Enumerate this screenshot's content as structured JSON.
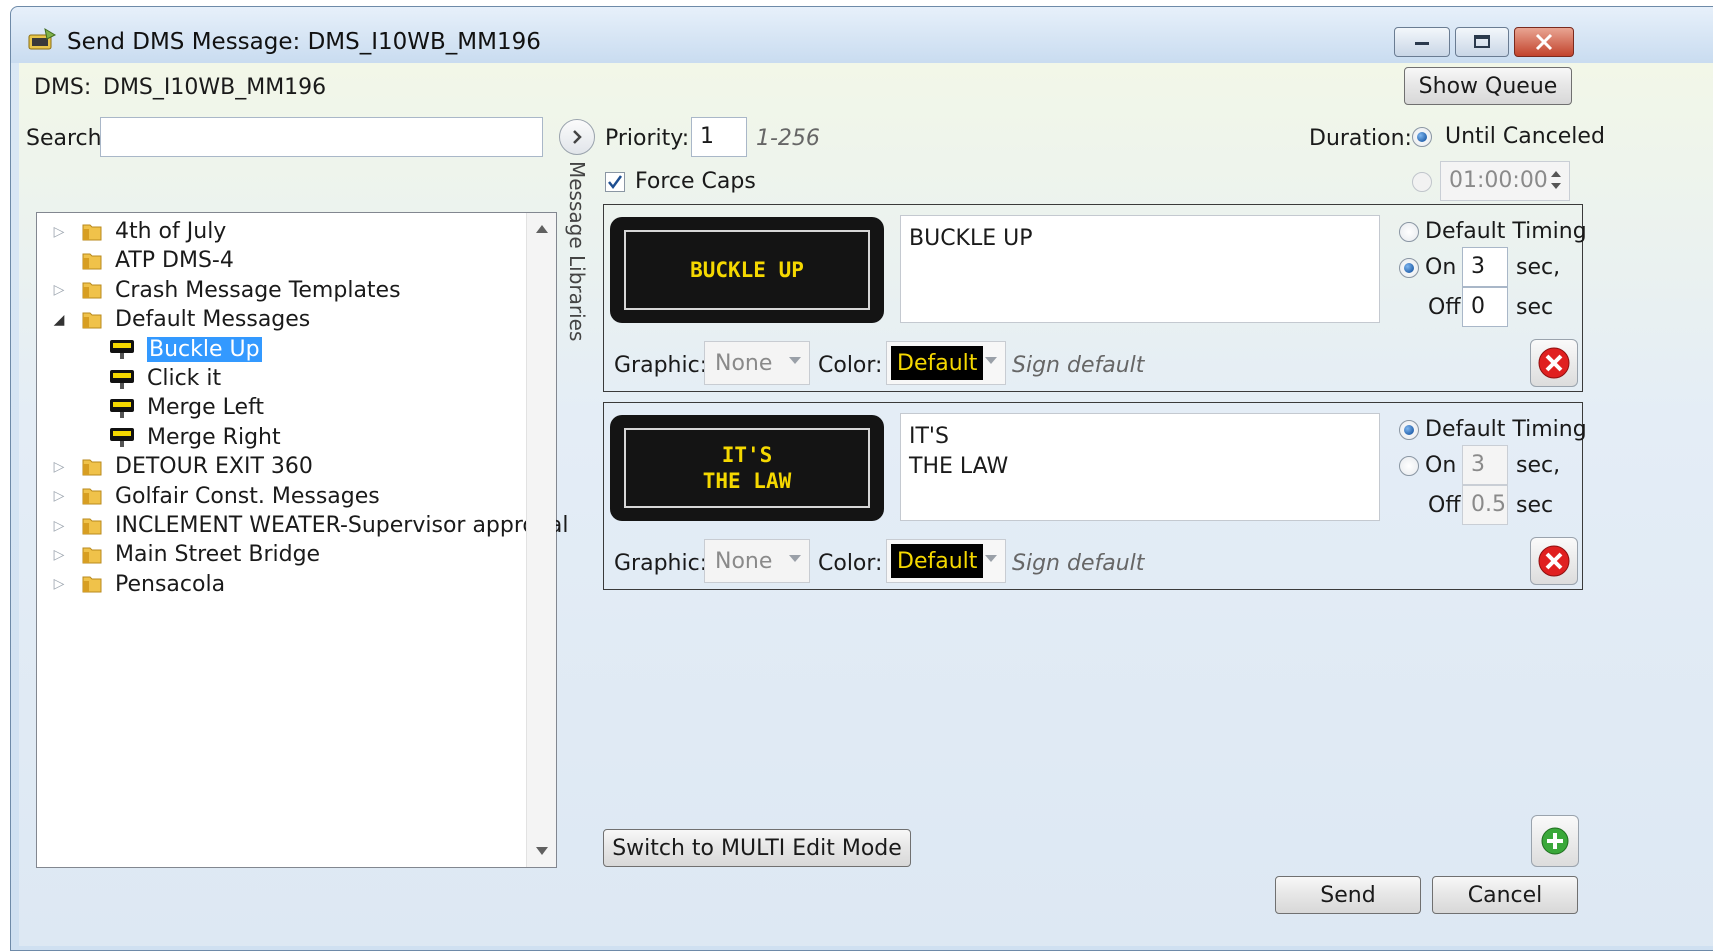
{
  "window": {
    "title": "Send DMS Message: DMS_I10WB_MM196"
  },
  "header": {
    "dms_label": "DMS:",
    "dms_value": "DMS_I10WB_MM196",
    "show_queue_label": "Show Queue"
  },
  "search": {
    "label": "Search:",
    "value": ""
  },
  "side_tab": {
    "label": "Message Libraries"
  },
  "tree": {
    "items": [
      {
        "label": "4th of July",
        "type": "folder",
        "expander": "▷"
      },
      {
        "label": "ATP DMS-4",
        "type": "folder",
        "expander": ""
      },
      {
        "label": "Crash Message Templates",
        "type": "folder",
        "expander": "▷"
      },
      {
        "label": "Default Messages",
        "type": "folder",
        "expander": "◢"
      },
      {
        "label": "Buckle Up",
        "type": "message",
        "selected": true
      },
      {
        "label": "Click it",
        "type": "message"
      },
      {
        "label": "Merge Left",
        "type": "message"
      },
      {
        "label": "Merge Right",
        "type": "message"
      },
      {
        "label": "DETOUR EXIT 360",
        "type": "folder",
        "expander": "▷"
      },
      {
        "label": "Golfair Const. Messages",
        "type": "folder",
        "expander": "▷"
      },
      {
        "label": "INCLEMENT WEATER-Supervisor approval",
        "type": "folder",
        "expander": "▷"
      },
      {
        "label": "Main Street Bridge",
        "type": "folder",
        "expander": "▷"
      },
      {
        "label": "Pensacola",
        "type": "folder",
        "expander": "▷"
      }
    ]
  },
  "priority": {
    "label": "Priority:",
    "value": "1",
    "range_hint": "1-256"
  },
  "force_caps": {
    "label": "Force Caps",
    "checked": true
  },
  "duration": {
    "label": "Duration:",
    "until_canceled_label": "Until Canceled",
    "time_value": "01:00:00"
  },
  "pages": [
    {
      "preview_line1": "BUCKLE UP",
      "preview_line2": "",
      "text_line1": "BUCKLE UP",
      "text_line2": "",
      "default_timing_label": "Default Timing",
      "on_label": "On",
      "on_value": "3",
      "on_unit": "sec,",
      "off_label": "Off",
      "off_value": "0",
      "off_unit": "sec",
      "timing_mode": "custom",
      "graphic_label": "Graphic:",
      "graphic_value": "None",
      "color_label": "Color:",
      "color_value": "Default",
      "sign_default_hint": "Sign default"
    },
    {
      "preview_line1": "IT'S",
      "preview_line2": "THE LAW",
      "text_line1": "IT'S",
      "text_line2": "THE LAW",
      "default_timing_label": "Default Timing",
      "on_label": "On",
      "on_value": "3",
      "on_unit": "sec,",
      "off_label": "Off",
      "off_value": "0.5",
      "off_unit": "sec",
      "timing_mode": "default",
      "graphic_label": "Graphic:",
      "graphic_value": "None",
      "color_label": "Color:",
      "color_value": "Default",
      "sign_default_hint": "Sign default"
    }
  ],
  "footer": {
    "multi_edit_label": "Switch to MULTI Edit Mode",
    "send_label": "Send",
    "cancel_label": "Cancel"
  },
  "colors": {
    "sign_text": "#f5d800",
    "selection": "#3399ff",
    "delete_icon": "#e02020",
    "add_icon": "#3aa83a"
  }
}
